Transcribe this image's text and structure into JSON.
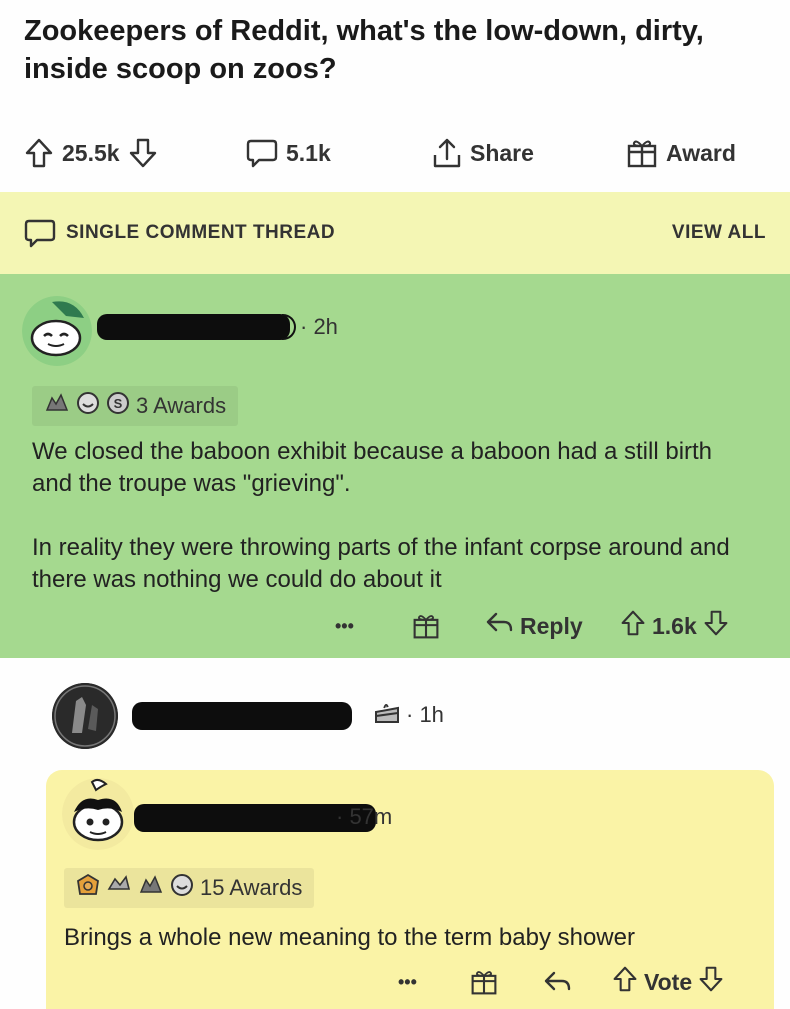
{
  "post": {
    "title": "Zookeepers of Reddit, what's the low-down, dirty, inside scoop on zoos?",
    "upvotes": "25.5k",
    "comments": "5.1k",
    "share_label": "Share",
    "award_label": "Award"
  },
  "thread_bar": {
    "label": "SINGLE COMMENT THREAD",
    "view_all": "VIEW ALL"
  },
  "comment1": {
    "meta": "· 2h",
    "awards_label": "3 Awards",
    "paragraph1": "We closed the baboon exhibit because a baboon had a still birth and the troupe was \"grieving\".",
    "paragraph2": "In reality they were throwing parts of the infant corpse around and there was nothing we could do about it",
    "more": "•••",
    "reply_label": "Reply",
    "score": "1.6k"
  },
  "comment_parent2": {
    "meta": "· 1h"
  },
  "comment2": {
    "meta": "· 57m",
    "awards_label": "15 Awards",
    "text": "Brings a whole new meaning to the term baby shower",
    "more": "•••",
    "vote_label": "Vote"
  },
  "colors": {
    "thread_bar_bg": "#f4f6b4",
    "comment1_bg": "#a5d98f",
    "comment2_bg": "#faf3a6"
  }
}
